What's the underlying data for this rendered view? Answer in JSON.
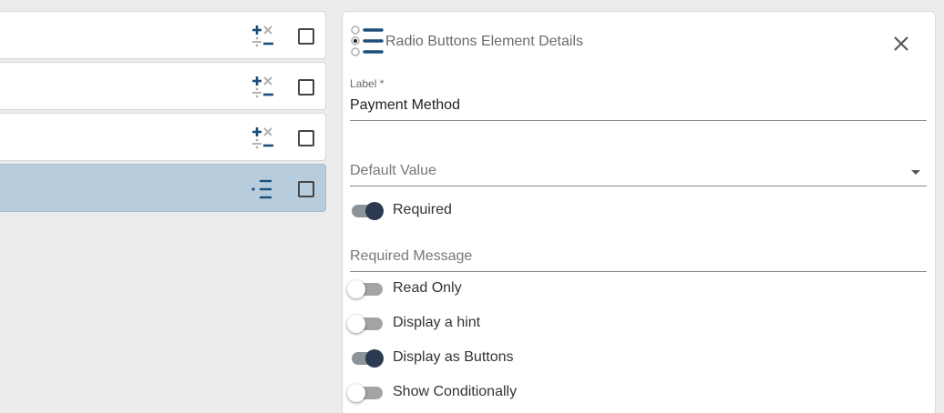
{
  "element_list": {
    "items": [
      {
        "icon": "calculation-icon",
        "selected": false
      },
      {
        "icon": "calculation-icon",
        "selected": false
      },
      {
        "icon": "calculation-icon",
        "selected": false
      },
      {
        "icon": "radio-list-icon",
        "selected": true
      }
    ]
  },
  "details_panel": {
    "title": "Radio Buttons Element Details",
    "header_icon": "radio-list-icon",
    "close_icon": "close-icon",
    "label_field": {
      "label": "Label *",
      "value": "Payment Method"
    },
    "default_value_field": {
      "placeholder": "Default Value",
      "value": ""
    },
    "required_toggle": {
      "label": "Required",
      "on": true
    },
    "required_message_field": {
      "placeholder": "Required Message",
      "value": ""
    },
    "read_only_toggle": {
      "label": "Read Only",
      "on": false
    },
    "display_hint_toggle": {
      "label": "Display a hint",
      "on": false
    },
    "display_as_buttons_toggle": {
      "label": "Display as Buttons",
      "on": true
    },
    "show_conditionally_toggle": {
      "label": "Show Conditionally",
      "on": false
    }
  },
  "colors": {
    "page_background": "#ececec",
    "selected_card": "#b7ccdd",
    "icon_blue": "#1b4f7a",
    "toggle_on_thumb": "#2b3a50"
  }
}
